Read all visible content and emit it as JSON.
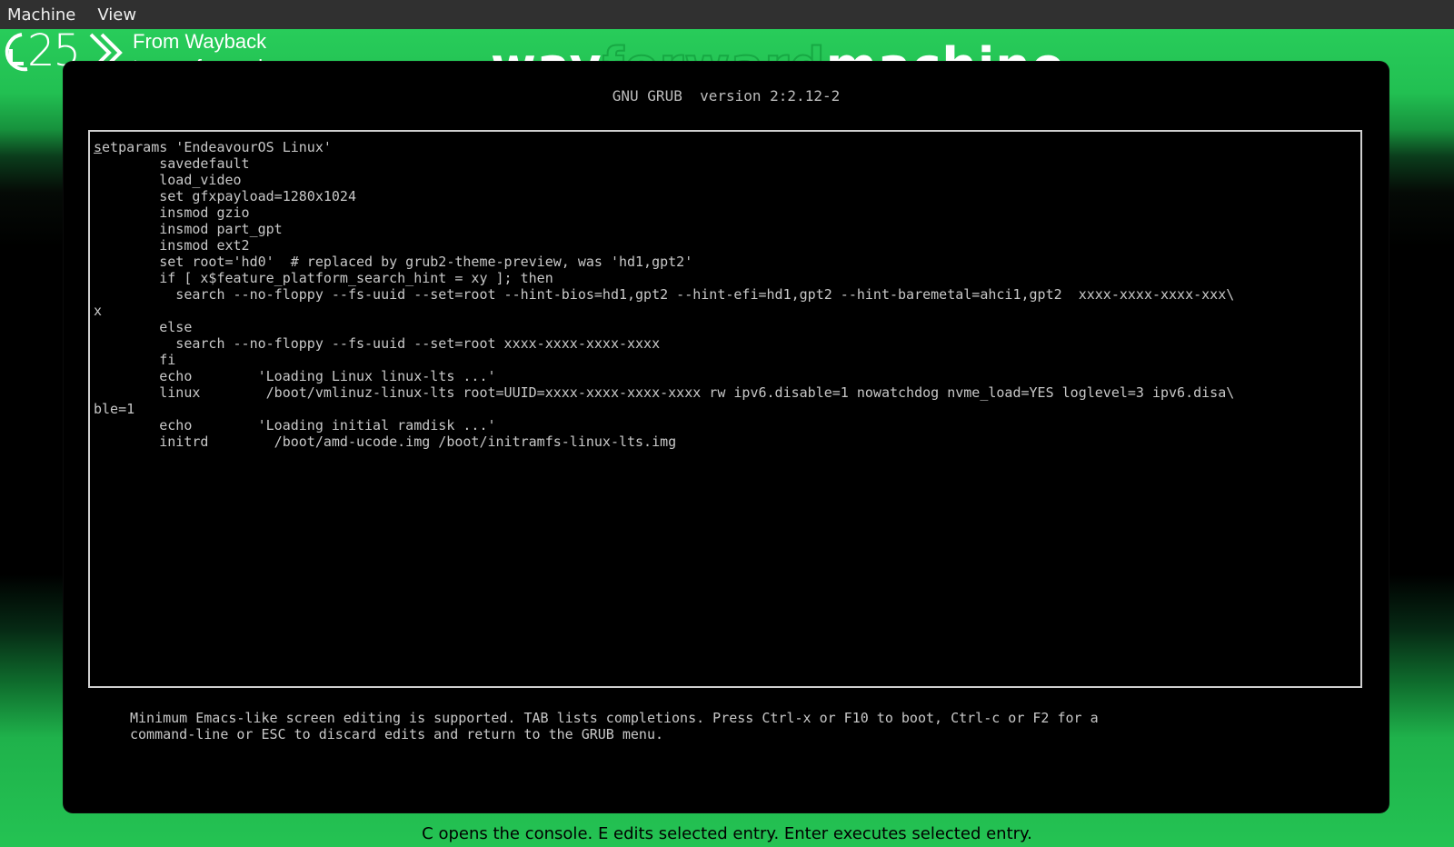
{
  "menubar": {
    "items": [
      "Machine",
      "View"
    ]
  },
  "banner": {
    "logo_number": "25",
    "tagline_line1": "From Wayback",
    "tagline_line2": "to way forward",
    "wordmark_part1": "way",
    "wordmark_part2": "forward",
    "wordmark_part3": "machine"
  },
  "grub": {
    "title": "GNU GRUB  version 2:2.12-2",
    "editor_first_char": "s",
    "editor_first_rest": "etparams 'EndeavourOS Linux'",
    "editor_body": "\n        savedefault\n        load_video\n        set gfxpayload=1280x1024\n        insmod gzio\n        insmod part_gpt\n        insmod ext2\n        set root='hd0'  # replaced by grub2-theme-preview, was 'hd1,gpt2'\n        if [ x$feature_platform_search_hint = xy ]; then\n          search --no-floppy --fs-uuid --set=root --hint-bios=hd1,gpt2 --hint-efi=hd1,gpt2 --hint-baremetal=ahci1,gpt2  xxxx-xxxx-xxxx-xxx\\\nx\n        else\n          search --no-floppy --fs-uuid --set=root xxxx-xxxx-xxxx-xxxx\n        fi\n        echo        'Loading Linux linux-lts ...'\n        linux        /boot/vmlinuz-linux-lts root=UUID=xxxx-xxxx-xxxx-xxxx rw ipv6.disable=1 nowatchdog nvme_load=YES loglevel=3 ipv6.disa\\\nble=1\n        echo        'Loading initial ramdisk ...'\n        initrd        /boot/amd-ucode.img /boot/initramfs-linux-lts.img",
    "help": "Minimum Emacs-like screen editing is supported. TAB lists completions. Press Ctrl-x or F10 to boot, Ctrl-c or F2 for a\ncommand-line or ESC to discard edits and return to the GRUB menu."
  },
  "status": {
    "text": "C opens the console. E edits selected entry. Enter executes selected entry."
  },
  "colors": {
    "menubar_bg": "#303030",
    "brand_green": "#24c353",
    "grub_text": "#c8c8c8",
    "grub_border": "#cfcfcf"
  }
}
